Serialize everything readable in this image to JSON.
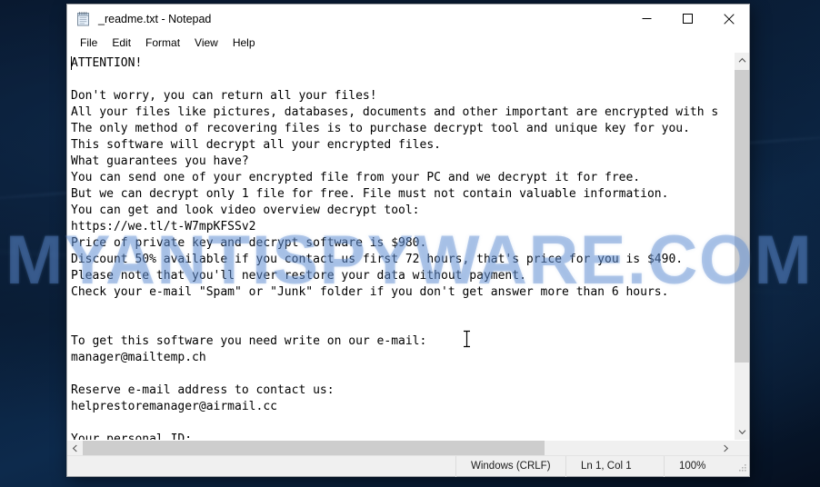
{
  "desktop": {
    "watermark": "MYANTISPYWARE.COM",
    "background_color": "#0a1e38"
  },
  "window": {
    "title": "_readme.txt - Notepad",
    "icon": "notepad-icon",
    "controls": {
      "minimize": "Minimize",
      "maximize": "Maximize",
      "close": "Close"
    }
  },
  "menu": {
    "items": [
      {
        "label": "File"
      },
      {
        "label": "Edit"
      },
      {
        "label": "Format"
      },
      {
        "label": "View"
      },
      {
        "label": "Help"
      }
    ]
  },
  "editor": {
    "text": "ATTENTION!\n\nDon't worry, you can return all your files!\nAll your files like pictures, databases, documents and other important are encrypted with s\nThe only method of recovering files is to purchase decrypt tool and unique key for you.\nThis software will decrypt all your encrypted files.\nWhat guarantees you have?\nYou can send one of your encrypted file from your PC and we decrypt it for free.\nBut we can decrypt only 1 file for free. File must not contain valuable information.\nYou can get and look video overview decrypt tool:\nhttps://we.tl/t-W7mpKFSSv2\nPrice of private key and decrypt software is $980.\nDiscount 50% available if you contact us first 72 hours, that's price for you is $490.\nPlease note that you'll never restore your data without payment.\nCheck your e-mail \"Spam\" or \"Junk\" folder if you don't get answer more than 6 hours.\n\n\nTo get this software you need write on our e-mail:\nmanager@mailtemp.ch\n\nReserve e-mail address to contact us:\nhelprestoremanager@airmail.cc\n\nYour personal ID:",
    "details": {
      "headline": "ATTENTION!",
      "video_url": "https://we.tl/t-W7mpKFSSv2",
      "price_full": "$980",
      "price_discount": "$490",
      "discount_percent": "50%",
      "discount_window_hours": "72",
      "answer_wait_hours": "6",
      "free_files": "1",
      "primary_email": "manager@mailtemp.ch",
      "reserve_email": "helprestoremanager@airmail.cc"
    }
  },
  "status_bar": {
    "encoding": "Windows (CRLF)",
    "position": "Ln 1, Col 1",
    "zoom": "100%"
  },
  "scrollbars": {
    "vertical_up": "scroll-up-icon",
    "vertical_down": "scroll-down-icon",
    "horizontal_left": "scroll-left-icon",
    "horizontal_right": "scroll-right-icon"
  }
}
